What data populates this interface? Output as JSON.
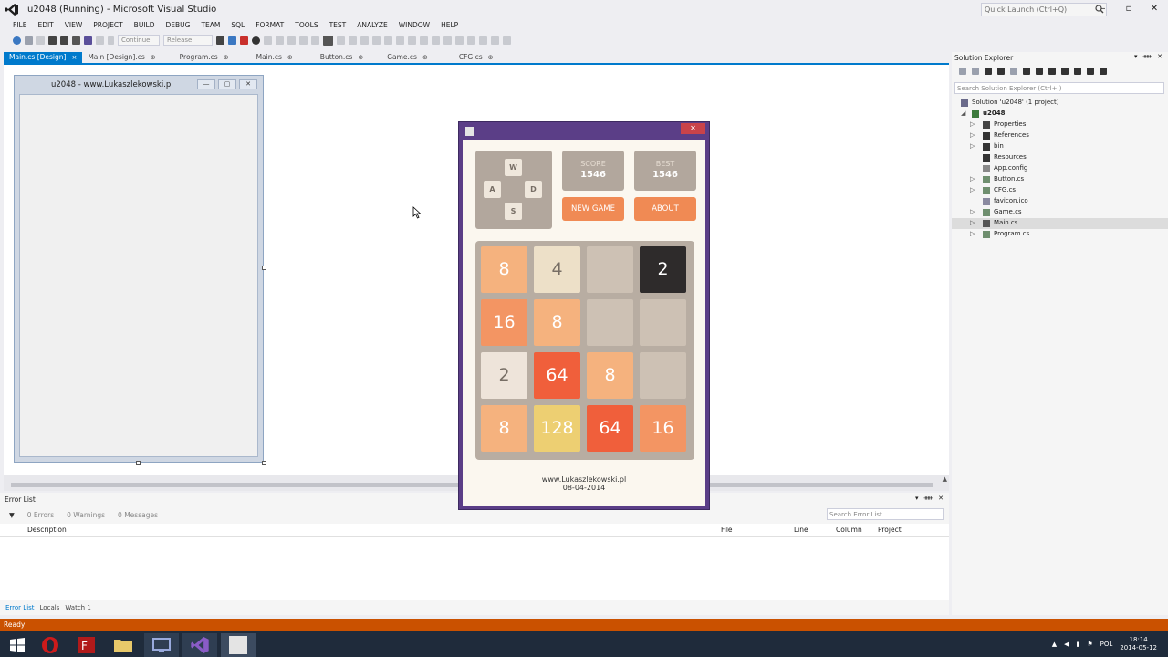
{
  "window": {
    "title": "u2048 (Running) - Microsoft Visual Studio",
    "quick_launch_placeholder": "Quick Launch (Ctrl+Q)"
  },
  "menu": [
    "FILE",
    "EDIT",
    "VIEW",
    "PROJECT",
    "BUILD",
    "DEBUG",
    "TEAM",
    "SQL",
    "FORMAT",
    "TOOLS",
    "TEST",
    "ANALYZE",
    "WINDOW",
    "HELP"
  ],
  "toolbar": {
    "continue_label": "Continue",
    "config_value": "Release"
  },
  "doc_tabs": [
    {
      "label": "Main.cs [Design]",
      "active": true
    },
    {
      "label": "Main [Design].cs",
      "active": false
    },
    {
      "label": "Program.cs",
      "active": false
    },
    {
      "label": "Main.cs",
      "active": false
    },
    {
      "label": "Button.cs",
      "active": false
    },
    {
      "label": "Game.cs",
      "active": false
    },
    {
      "label": "CFG.cs",
      "active": false
    }
  ],
  "designer": {
    "form_title": "u2048 - www.Lukaszlekowski.pl"
  },
  "error_list": {
    "title": "Error List",
    "filters": [
      "0 Errors",
      "0 Warnings",
      "0 Messages"
    ],
    "search_placeholder": "Search Error List",
    "columns": [
      "Description",
      "File",
      "Line",
      "Column",
      "Project"
    ],
    "bottom_tabs": [
      "Error List",
      "Locals",
      "Watch 1"
    ]
  },
  "solution_explorer": {
    "title": "Solution Explorer",
    "search_placeholder": "Search Solution Explorer (Ctrl+;)",
    "items": [
      {
        "label": "Solution 'u2048' (1 project)",
        "level": 0,
        "selected": false
      },
      {
        "label": "u2048",
        "level": 1,
        "selected": false
      },
      {
        "label": "Properties",
        "level": 2,
        "selected": false
      },
      {
        "label": "References",
        "level": 2,
        "selected": false
      },
      {
        "label": "bin",
        "level": 2,
        "selected": false
      },
      {
        "label": "Resources",
        "level": 2,
        "selected": false
      },
      {
        "label": "App.config",
        "level": 2,
        "selected": false
      },
      {
        "label": "Button.cs",
        "level": 2,
        "selected": false
      },
      {
        "label": "CFG.cs",
        "level": 2,
        "selected": false
      },
      {
        "label": "favicon.ico",
        "level": 2,
        "selected": false
      },
      {
        "label": "Game.cs",
        "level": 2,
        "selected": false
      },
      {
        "label": "Main.cs",
        "level": 2,
        "selected": true
      },
      {
        "label": "Program.cs",
        "level": 2,
        "selected": false
      }
    ]
  },
  "game": {
    "keys": {
      "up": "W",
      "left": "A",
      "right": "D",
      "down": "S"
    },
    "score": {
      "label": "SCORE",
      "value": "1546"
    },
    "best": {
      "label": "BEST",
      "value": "1546"
    },
    "new_game": "NEW GAME",
    "about": "ABOUT",
    "board": [
      [
        "8",
        "4",
        "",
        "2"
      ],
      [
        "16",
        "8",
        "",
        ""
      ],
      [
        "2",
        "64",
        "8",
        ""
      ],
      [
        "8",
        "128",
        "64",
        "16"
      ]
    ],
    "footer_line1": "www.Lukaszlekowski.pl",
    "footer_line2": "08-04-2014",
    "tile_colors": {
      "": "#cdc1b4",
      "2": "#eee4da",
      "4": "#ede0c8",
      "8": "#f5b27e",
      "16": "#f39563",
      "64": "#f05f3b",
      "128": "#edcf72",
      "dark2": "#2e2b2b"
    }
  },
  "status": {
    "text": "Ready"
  },
  "taskbar": {
    "language": "POL",
    "time": "18:14",
    "date": "2014-05-12"
  }
}
